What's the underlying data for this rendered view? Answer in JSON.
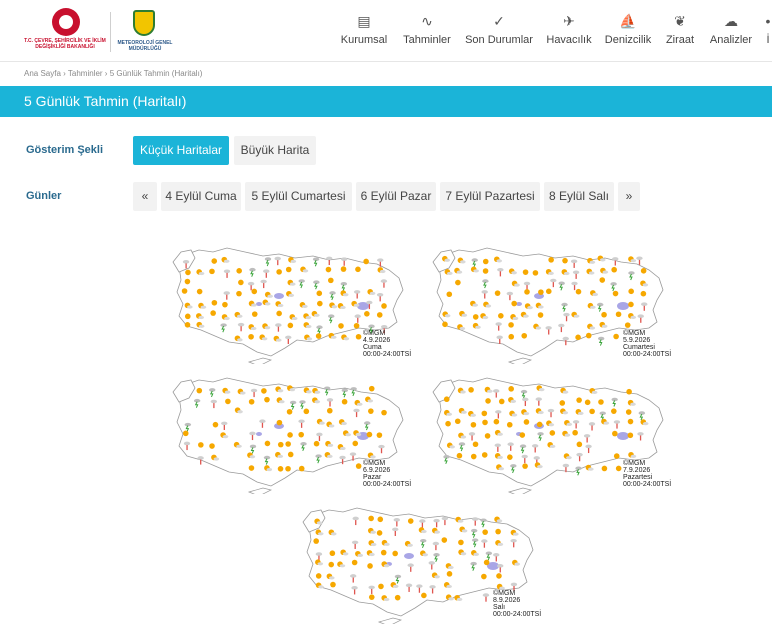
{
  "header": {
    "ministry_logo_text": "T.C. ÇEVRE, ŞEHİRCİLİK VE İKLİM DEĞİŞİKLİĞİ BAKANLIĞI",
    "mgm_logo_text": "METEOROLOJİ GENEL MÜDÜRLÜĞÜ",
    "nav": [
      {
        "label": "Kurumsal",
        "icon": "document-icon"
      },
      {
        "label": "Tahminler",
        "icon": "chart-icon"
      },
      {
        "label": "Son Durumlar",
        "icon": "check-circle-icon"
      },
      {
        "label": "Havacılık",
        "icon": "airplane-icon"
      },
      {
        "label": "Denizcilik",
        "icon": "sailboat-icon"
      },
      {
        "label": "Ziraat",
        "icon": "leaf-icon"
      },
      {
        "label": "Analizler",
        "icon": "cloud-analysis-icon"
      },
      {
        "label": "İ",
        "icon": "more-icon"
      }
    ]
  },
  "breadcrumb": [
    "Ana Sayfa",
    "Tahminler",
    "5 Günlük Tahmin (Haritalı)"
  ],
  "page_title": "5 Günlük Tahmin (Haritalı)",
  "display_mode": {
    "label": "Gösterim Şekli",
    "options": [
      "Küçük Haritalar",
      "Büyük Harita"
    ],
    "selected": "Küçük Haritalar"
  },
  "days": {
    "label": "Günler",
    "prev": "«",
    "next": "»",
    "items": [
      "4 Eylül Cuma",
      "5 Eylül Cumartesi",
      "6 Eylül Pazar",
      "7 Eylül Pazartesi",
      "8 Eylül Salı"
    ]
  },
  "maps": [
    {
      "credit": "©MGM",
      "date": "4.9.2026",
      "weekday": "Cuma",
      "time": "00:00-24:00TSİ"
    },
    {
      "credit": "©MGM",
      "date": "5.9.2026",
      "weekday": "Cumartesi",
      "time": "00:00-24:00TSİ"
    },
    {
      "credit": "©MGM",
      "date": "6.9.2026",
      "weekday": "Pazar",
      "time": "00:00-24:00TSİ"
    },
    {
      "credit": "©MGM",
      "date": "7.9.2026",
      "weekday": "Pazartesi",
      "time": "00:00-24:00TSİ"
    },
    {
      "credit": "©MGM",
      "date": "8.9.2026",
      "weekday": "Salı",
      "time": "00:00-24:00TSİ"
    }
  ],
  "colors": {
    "accent": "#1bb4d8",
    "label": "#2a6a8e",
    "sun": "#f6a800",
    "rain": "#e0554f",
    "lake": "#a9a6e6"
  }
}
